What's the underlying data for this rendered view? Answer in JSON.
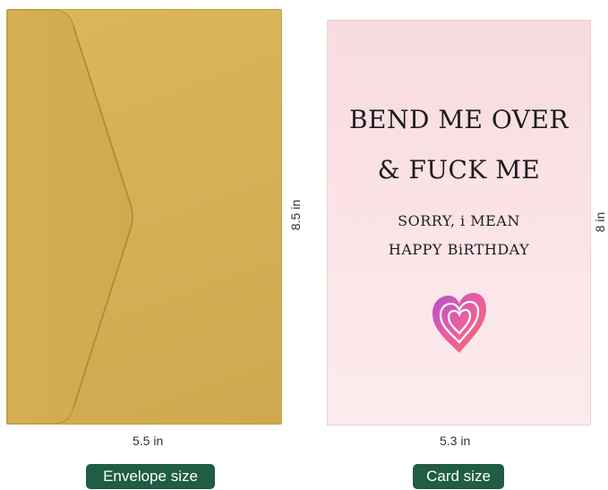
{
  "colors": {
    "envelope_gold": "#d8b157",
    "card_pink": "#fbe5e8",
    "tag_green": "#1f5d45",
    "heart_pink": "#e95fa0"
  },
  "envelope": {
    "width_label": "5.5 in",
    "height_label": "8.5 in",
    "tag_label": "Envelope size"
  },
  "card": {
    "line1": "BEND ME OVER",
    "line2": "& FUCK ME",
    "line3": "SORRY, i MEAN",
    "line4": "HAPPY BiRTHDAY",
    "width_label": "5.3 in",
    "height_label": "8 in",
    "tag_label": "Card size",
    "heart_icon": "heart-icon"
  }
}
